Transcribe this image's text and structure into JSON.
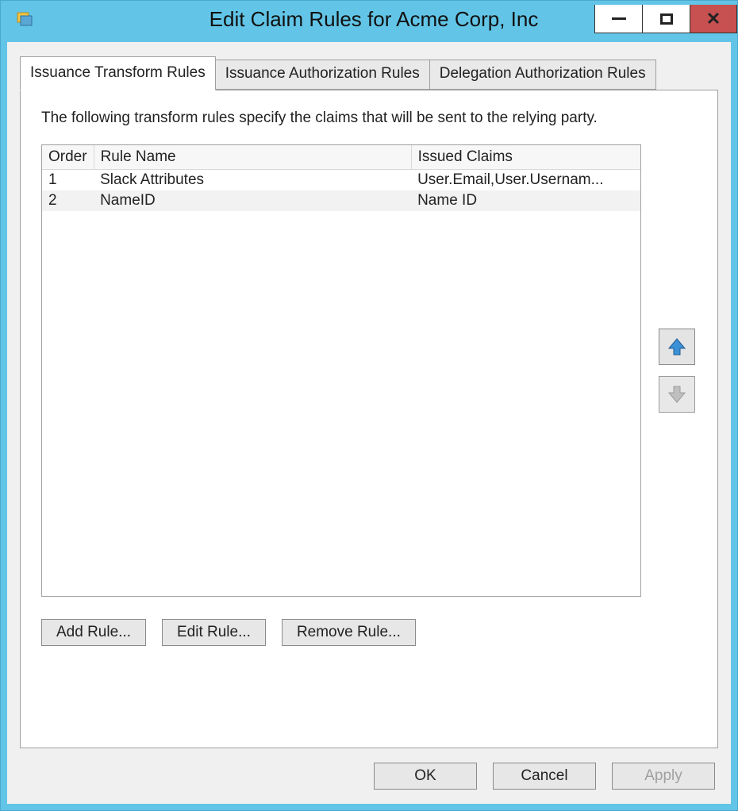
{
  "window": {
    "title": "Edit Claim Rules for Acme Corp, Inc"
  },
  "tabs": {
    "items": [
      {
        "label": "Issuance Transform Rules",
        "active": true
      },
      {
        "label": "Issuance Authorization Rules",
        "active": false
      },
      {
        "label": "Delegation Authorization Rules",
        "active": false
      }
    ]
  },
  "panel": {
    "description": "The following transform rules specify the claims that will be sent to the relying party.",
    "columns": {
      "order": "Order",
      "rule_name": "Rule Name",
      "issued_claims": "Issued Claims"
    },
    "rules": [
      {
        "order": "1",
        "rule_name": "Slack Attributes",
        "issued_claims": "User.Email,User.Usernam..."
      },
      {
        "order": "2",
        "rule_name": "NameID",
        "issued_claims": "Name ID"
      }
    ],
    "buttons": {
      "add": "Add Rule...",
      "edit": "Edit Rule...",
      "remove": "Remove Rule..."
    }
  },
  "footer": {
    "ok": "OK",
    "cancel": "Cancel",
    "apply": "Apply"
  }
}
